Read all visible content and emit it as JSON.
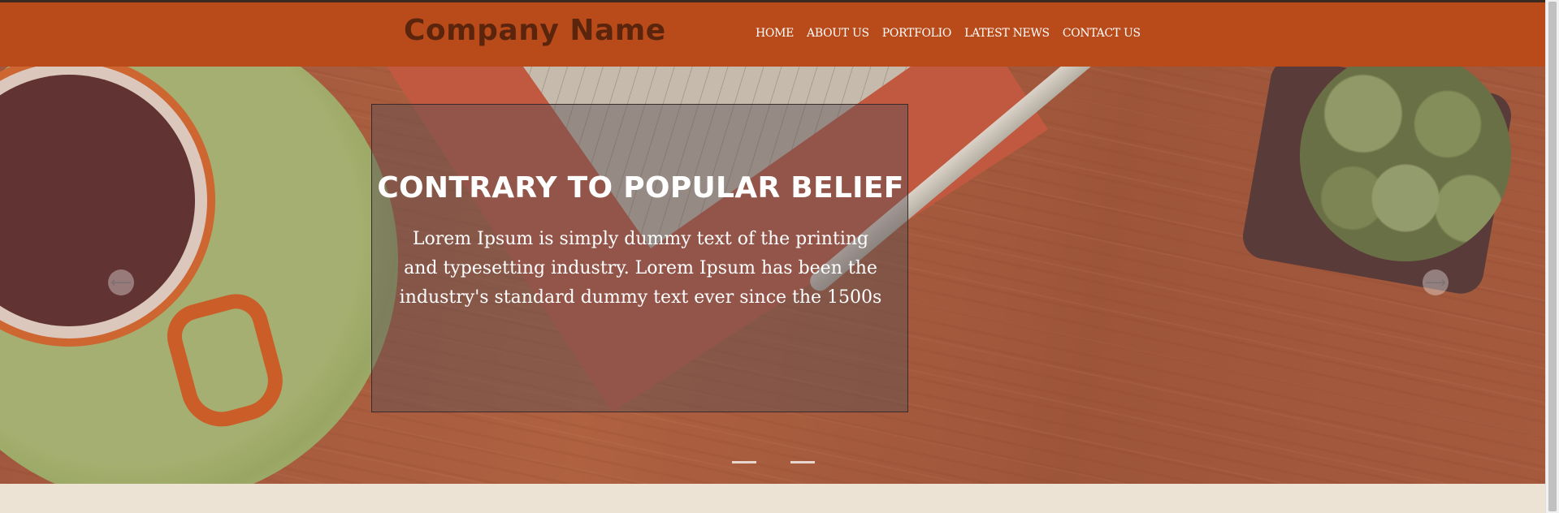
{
  "header": {
    "company_name": "Company Name",
    "nav": [
      "HOME",
      "ABOUT US",
      "PORTFOLIO",
      "LATEST NEWS",
      "CONTACT US"
    ]
  },
  "hero": {
    "title": "CONTRARY TO POPULAR BELIEF",
    "text": "Lorem Ipsum is simply dummy text of the printing and typesetting industry. Lorem Ipsum has been the industry's standard dummy text ever since the 1500s",
    "prev_icon": "arrow-left-icon",
    "next_icon": "arrow-right-icon",
    "prev_glyph": "⟵",
    "next_glyph": "⟶",
    "slide_count": 2
  },
  "colors": {
    "header_bg": "#b94b1b",
    "logo": "#5a250c",
    "page_bg": "#ece3d5"
  }
}
